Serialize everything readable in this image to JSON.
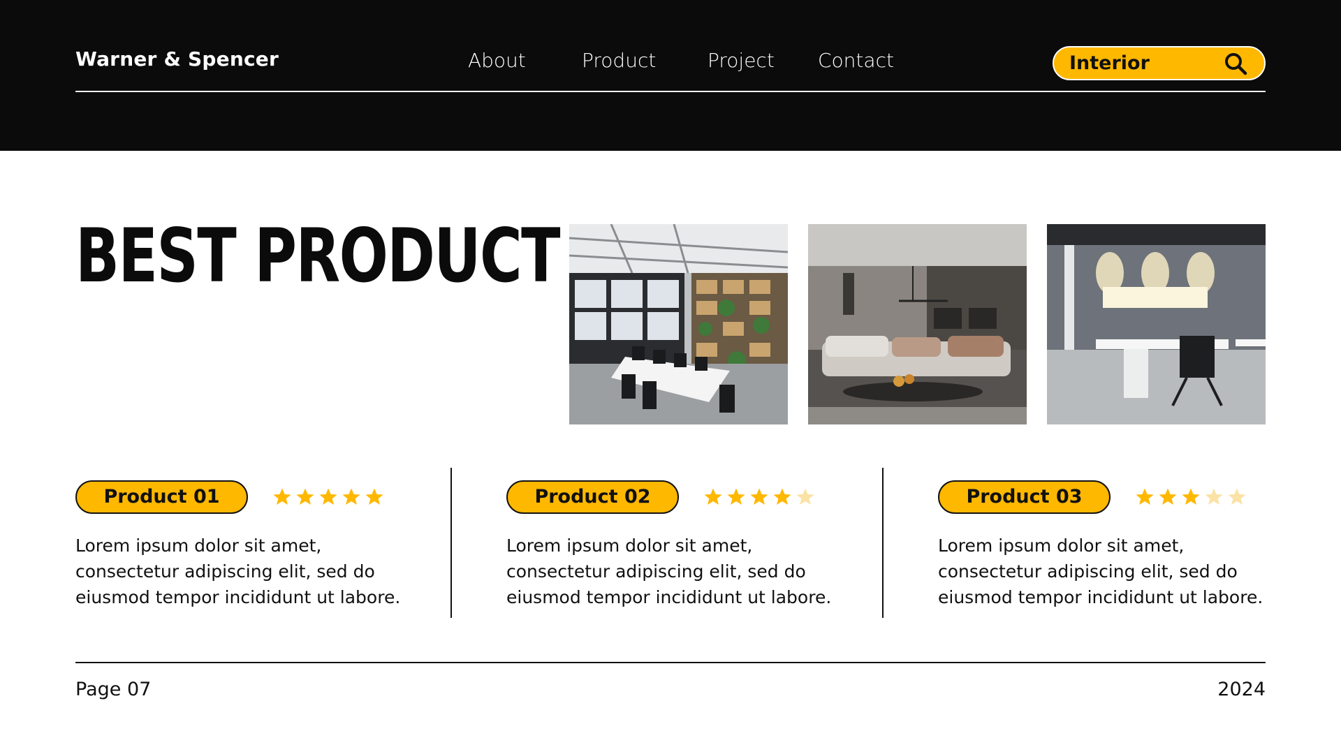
{
  "header": {
    "brand": "Warner & Spencer",
    "nav": [
      "About",
      "Product",
      "Project",
      "Contact"
    ],
    "search": {
      "value": "Interior"
    }
  },
  "main": {
    "title": "BEST PRODUCT",
    "products": [
      {
        "label": "Product 01",
        "rating": 5,
        "max_rating": 5,
        "description": "Lorem ipsum dolor sit amet, consectetur adipiscing elit, sed do eiusmod tempor incididunt ut labore."
      },
      {
        "label": "Product 02",
        "rating": 4,
        "max_rating": 5,
        "description": "Lorem ipsum dolor sit amet, consectetur adipiscing elit, sed do eiusmod tempor incididunt ut labore."
      },
      {
        "label": "Product 03",
        "rating": 3,
        "max_rating": 5,
        "description": "Lorem ipsum dolor sit amet, consectetur adipiscing elit, sed do eiusmod tempor incididunt ut labore."
      }
    ]
  },
  "footer": {
    "page": "Page 07",
    "year": "2024"
  },
  "colors": {
    "accent": "#FFB800",
    "header_bg": "#0B0B0B",
    "star_empty": "#FBE3A6"
  }
}
